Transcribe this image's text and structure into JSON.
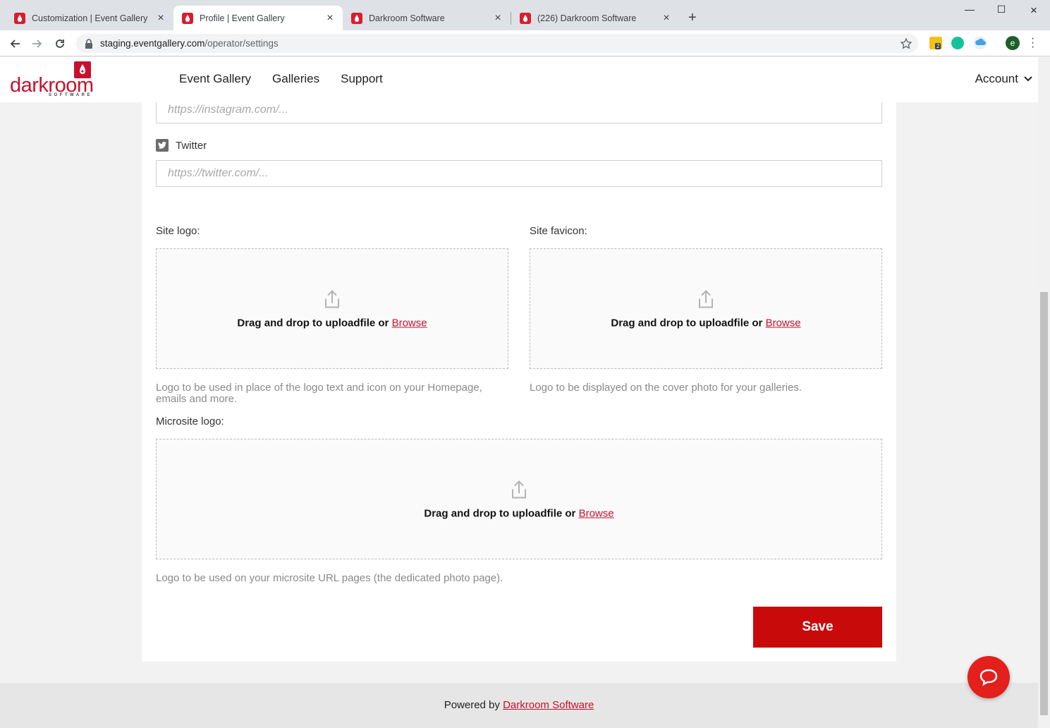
{
  "browser": {
    "tabs": [
      {
        "title": "Customization | Event Gallery",
        "active": false
      },
      {
        "title": "Profile | Event Gallery",
        "active": true
      },
      {
        "title": "Darkroom Software",
        "active": false
      },
      {
        "title": "(226) Darkroom Software",
        "active": false
      }
    ],
    "url_host": "staging.eventgallery.com",
    "url_path": "/operator/settings",
    "extension_badge": "2",
    "profile_initial": "e"
  },
  "header": {
    "logo_word": "darkroom",
    "logo_sub": "SOFTWARE",
    "nav": [
      "Event Gallery",
      "Galleries",
      "Support"
    ],
    "account_label": "Account"
  },
  "form": {
    "instagram_placeholder": "https://instagram.com/...",
    "twitter_label": "Twitter",
    "twitter_placeholder": "https://twitter.com/...",
    "site_logo": {
      "label": "Site logo:",
      "drop_text": "Drag and drop to uploadfile or",
      "browse": "Browse",
      "help": "Logo to be used in place of the logo text and icon on your Homepage, emails and more."
    },
    "site_favicon": {
      "label": "Site favicon:",
      "drop_text": "Drag and drop to uploadfile or",
      "browse": "Browse",
      "help": "Logo to be displayed on the cover photo for your galleries."
    },
    "microsite_logo": {
      "label": "Microsite logo:",
      "drop_text": "Drag and drop to uploadfile or",
      "browse": "Browse",
      "help": "Logo to be used on your microsite URL pages (the dedicated photo page)."
    },
    "save_label": "Save"
  },
  "footer": {
    "powered_by": "Powered by",
    "link": "Darkroom Software"
  },
  "colors": {
    "brand_red": "#c8102e",
    "save_red": "#c80a0a"
  }
}
